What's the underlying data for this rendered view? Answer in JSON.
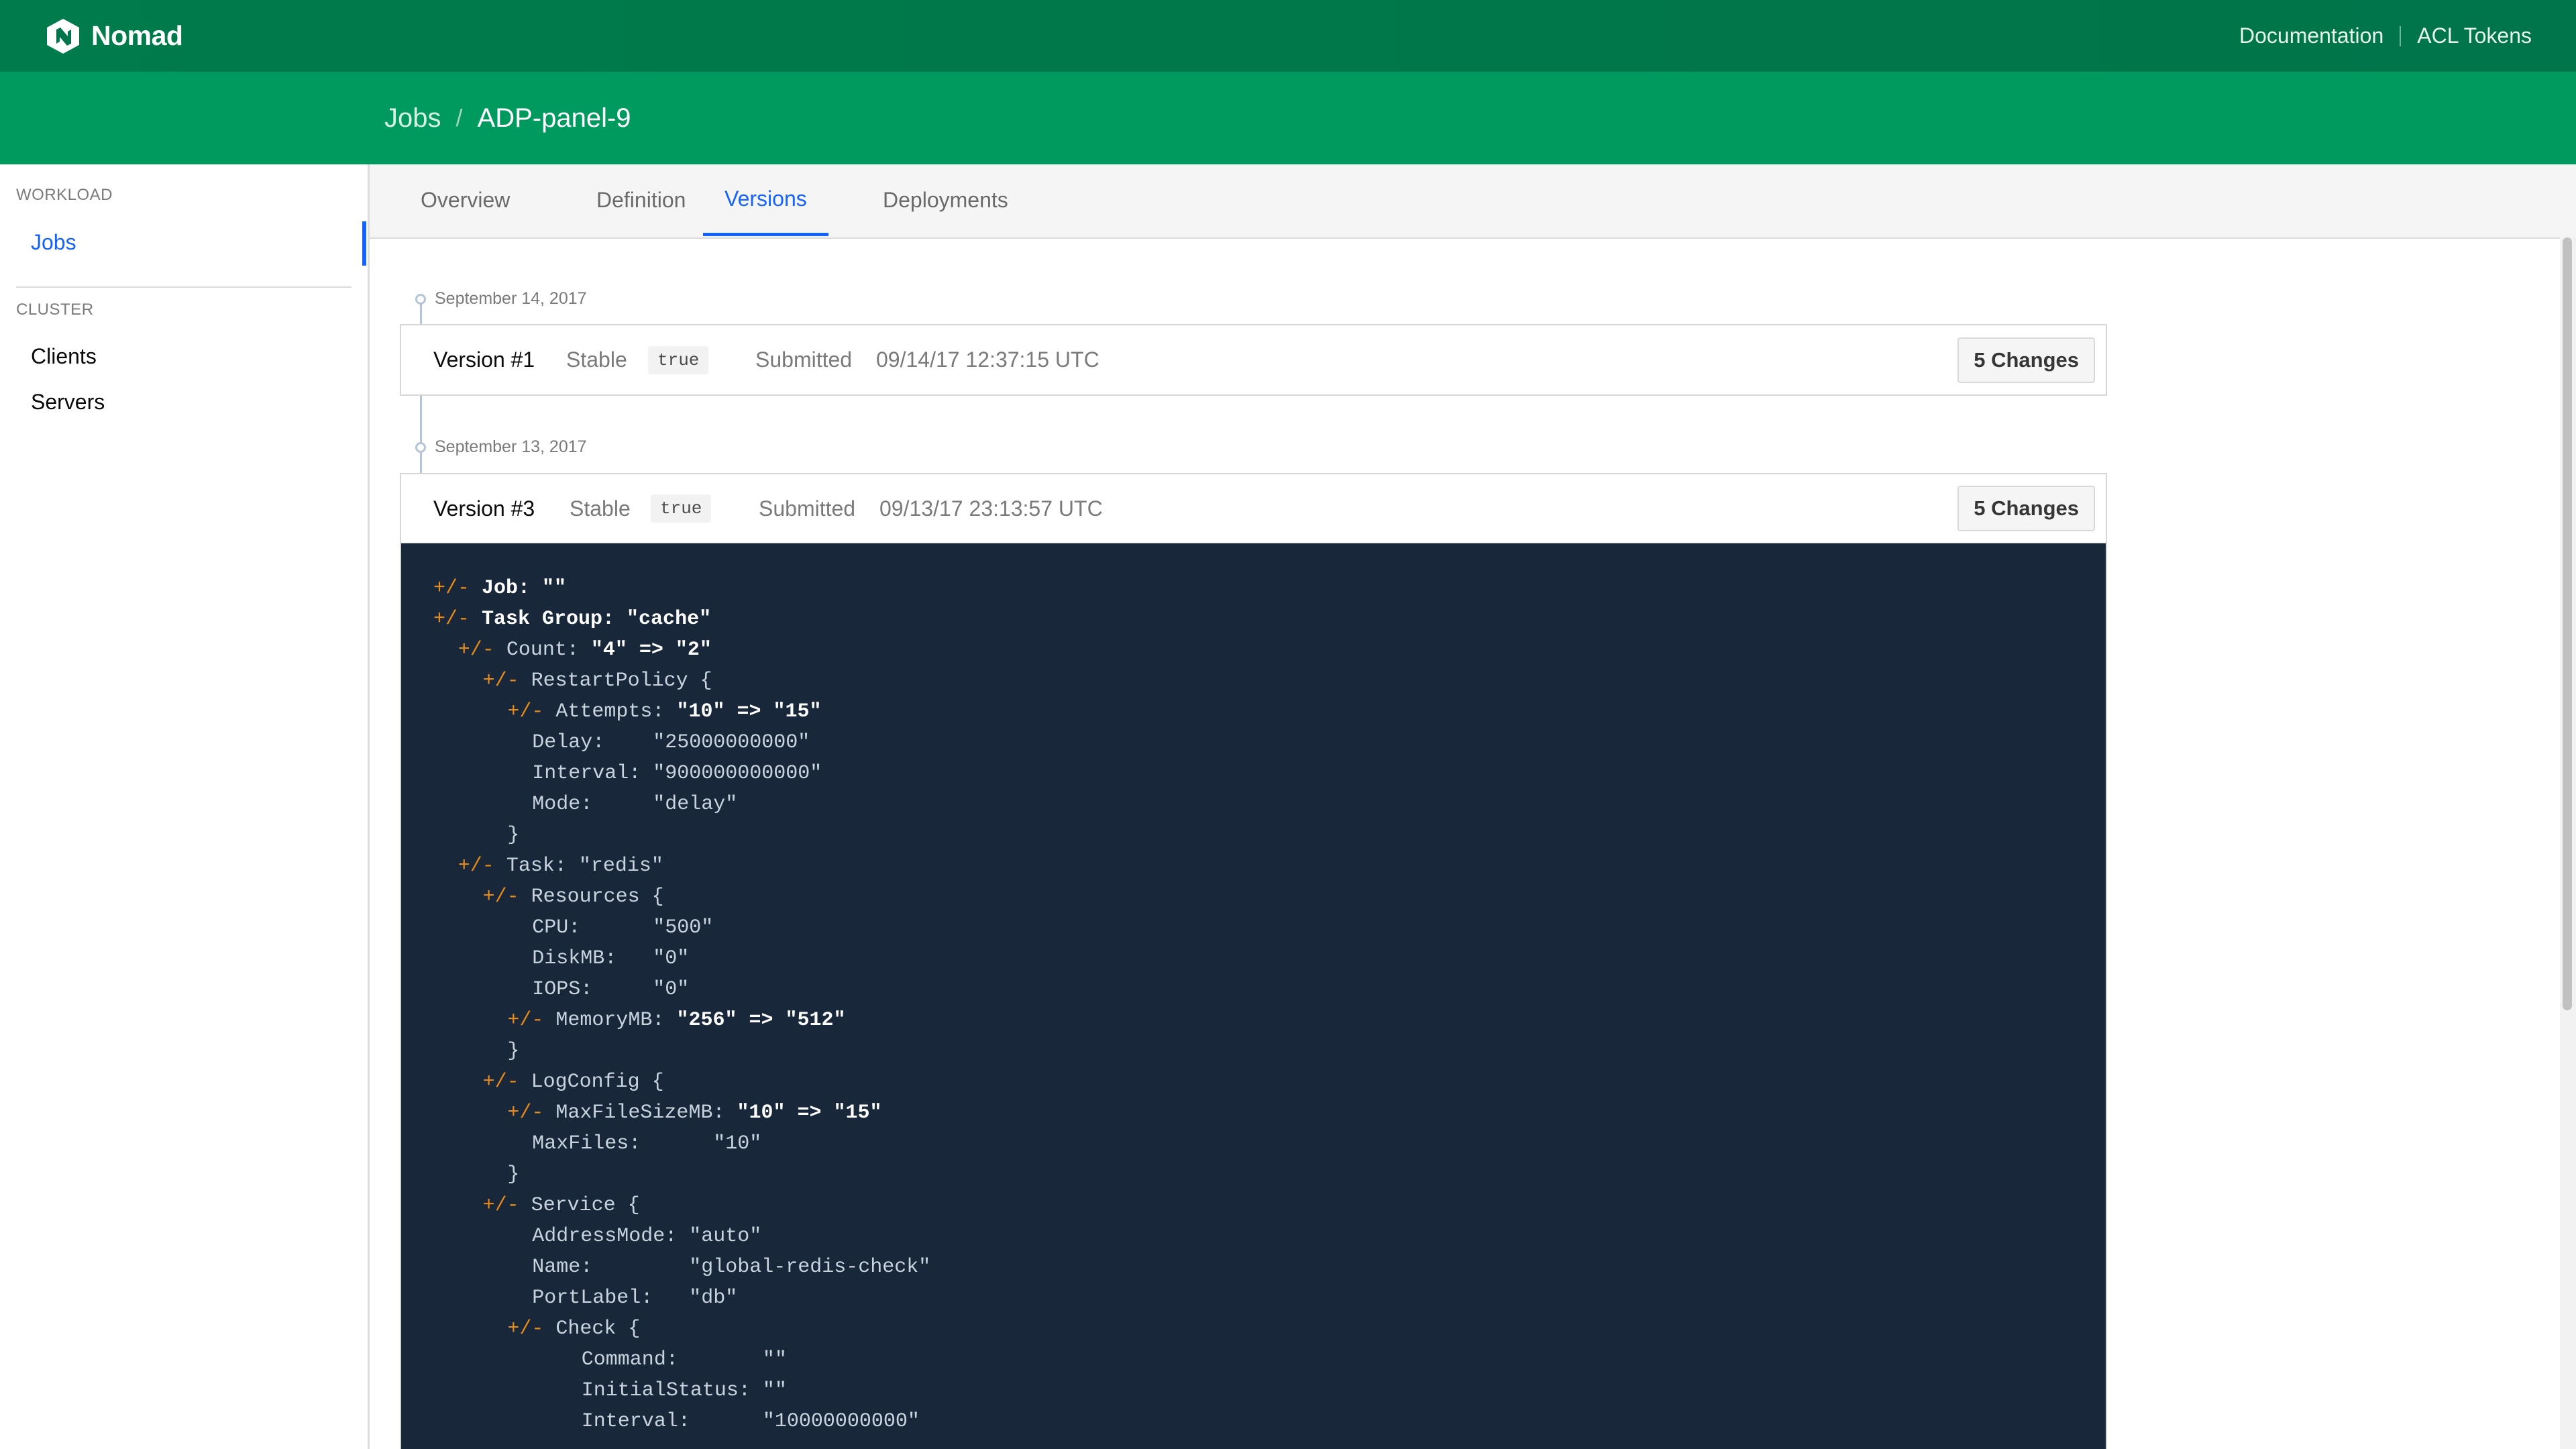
{
  "app": {
    "name": "Nomad"
  },
  "navbar": {
    "links": [
      "Documentation",
      "ACL Tokens"
    ]
  },
  "breadcrumb": {
    "root": "Jobs",
    "current": "ADP-panel-9"
  },
  "sidebar": {
    "sections": [
      {
        "label": "WORKLOAD",
        "items": [
          {
            "label": "Jobs",
            "active": true
          }
        ]
      },
      {
        "label": "CLUSTER",
        "items": [
          {
            "label": "Clients"
          },
          {
            "label": "Servers"
          }
        ]
      }
    ]
  },
  "tabs": [
    {
      "label": "Overview"
    },
    {
      "label": "Definition"
    },
    {
      "label": "Versions",
      "active": true
    },
    {
      "label": "Deployments"
    }
  ],
  "versions": [
    {
      "date": "September 14, 2017",
      "title": "Version #1",
      "stable_label": "Stable",
      "stable_value": "true",
      "submitted_label": "Submitted",
      "submitted_value": "09/14/17 12:37:15 UTC",
      "changes_label": "5 Changes"
    },
    {
      "date": "September 13, 2017",
      "title": "Version #3",
      "stable_label": "Stable",
      "stable_value": "true",
      "submitted_label": "Submitted",
      "submitted_value": "09/13/17 23:13:57 UTC",
      "changes_label": "5 Changes"
    }
  ],
  "diff": {
    "lines": [
      {
        "indent": 0,
        "marker": "+/- ",
        "text": "Job: \"\"",
        "bold": true
      },
      {
        "indent": 0,
        "marker": "+/- ",
        "text": "Task Group: \"cache\"",
        "bold": true
      },
      {
        "indent": 1,
        "marker": "+/- ",
        "key": "Count: ",
        "value": "\"4\" => \"2\"",
        "value_bold": true
      },
      {
        "indent": 2,
        "marker": "+/- ",
        "text": "RestartPolicy {"
      },
      {
        "indent": 3,
        "marker": "+/- ",
        "key": "Attempts: ",
        "value": "\"10\" => \"15\"",
        "value_bold": true
      },
      {
        "indent": 4,
        "text": "Delay:    \"25000000000\""
      },
      {
        "indent": 4,
        "text": "Interval: \"900000000000\""
      },
      {
        "indent": 4,
        "text": "Mode:     \"delay\""
      },
      {
        "indent": 4,
        "text": "}",
        "shift": -1
      },
      {
        "indent": 1,
        "marker": "+/- ",
        "text": "Task: \"redis\""
      },
      {
        "indent": 2,
        "marker": "+/- ",
        "text": "Resources {"
      },
      {
        "indent": 4,
        "text": "CPU:      \"500\""
      },
      {
        "indent": 4,
        "text": "DiskMB:   \"0\""
      },
      {
        "indent": 4,
        "text": "IOPS:     \"0\""
      },
      {
        "indent": 3,
        "marker": "+/- ",
        "key": "MemoryMB: ",
        "value": "\"256\" => \"512\"",
        "value_bold": true
      },
      {
        "indent": 4,
        "text": "}",
        "shift": -1
      },
      {
        "indent": 2,
        "marker": "+/- ",
        "text": "LogConfig {"
      },
      {
        "indent": 3,
        "marker": "+/- ",
        "key": "MaxFileSizeMB: ",
        "value": "\"10\" => \"15\"",
        "value_bold": true
      },
      {
        "indent": 4,
        "text": "MaxFiles:      \"10\""
      },
      {
        "indent": 4,
        "text": "}",
        "shift": -1
      },
      {
        "indent": 2,
        "marker": "+/- ",
        "text": "Service {"
      },
      {
        "indent": 4,
        "text": "AddressMode: \"auto\""
      },
      {
        "indent": 4,
        "text": "Name:        \"global-redis-check\""
      },
      {
        "indent": 4,
        "text": "PortLabel:   \"db\""
      },
      {
        "indent": 4,
        "marker": "+/- ",
        "text": "Check {",
        "shift": -1
      },
      {
        "indent": 6,
        "text": "Command:       \"\""
      },
      {
        "indent": 6,
        "text": "InitialStatus: \"\""
      },
      {
        "indent": 6,
        "text": "Interval:      \"10000000000\""
      }
    ]
  },
  "colors": {
    "navbar": "#007b4b",
    "header": "#009a5f",
    "accent": "#1563ff",
    "diff_bg": "#18283a",
    "diff_marker": "#e88a1a"
  }
}
